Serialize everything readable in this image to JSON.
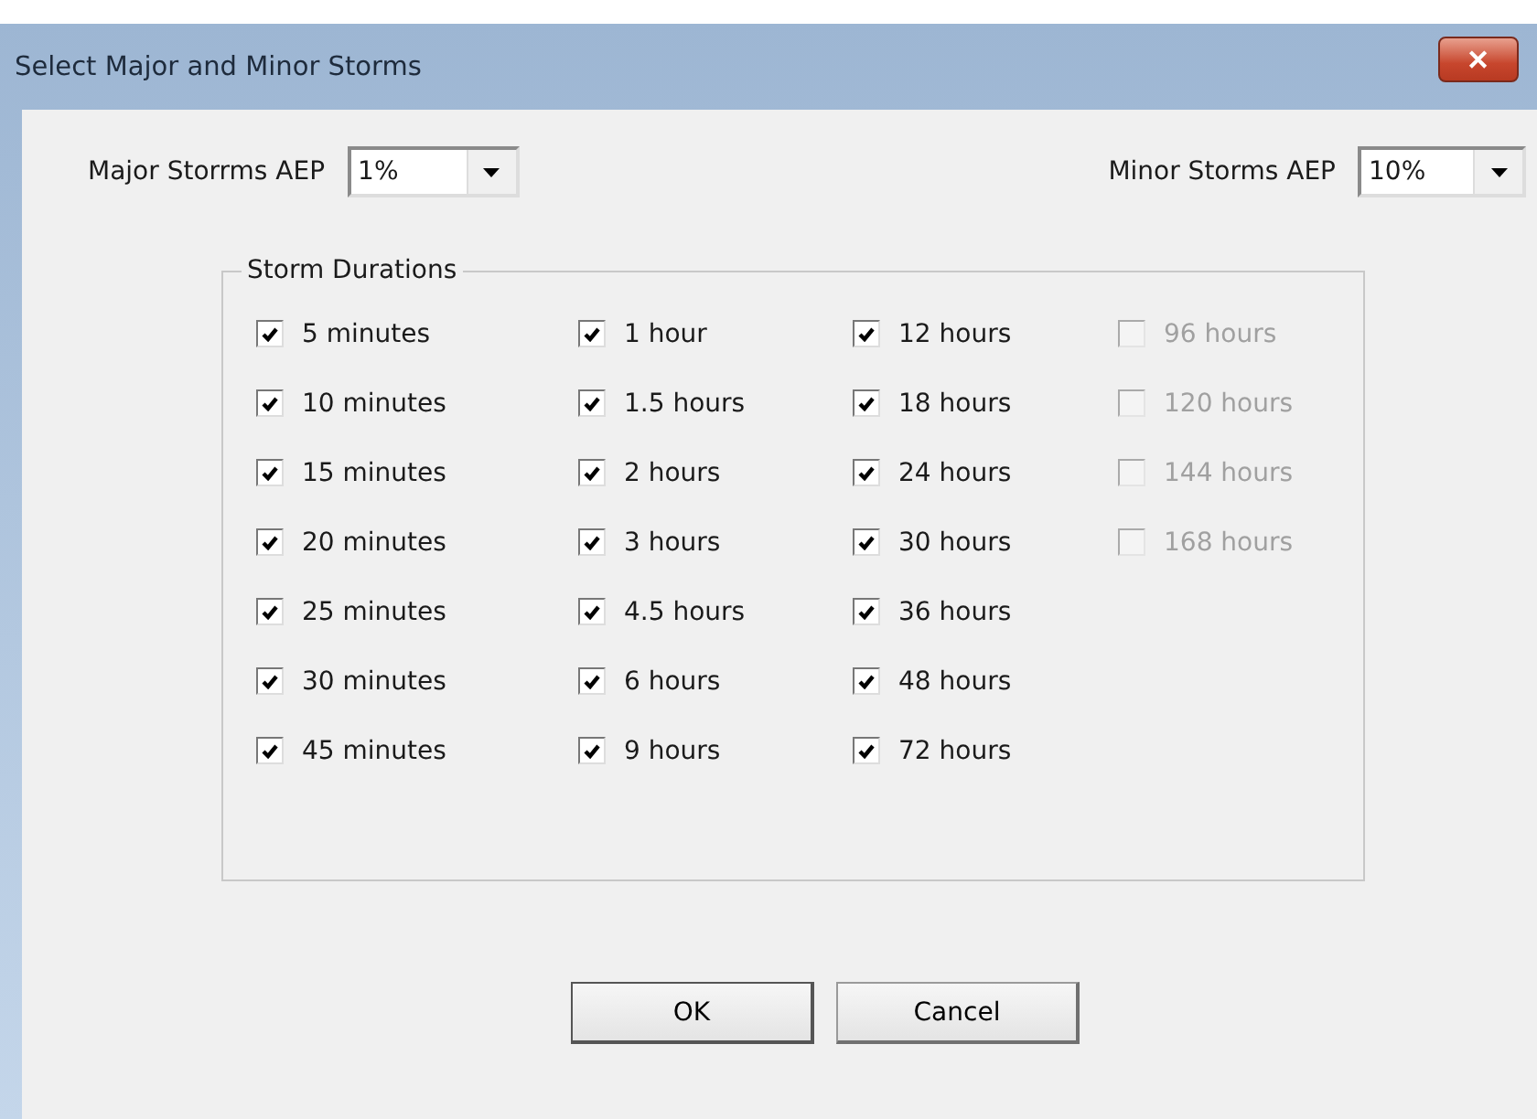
{
  "window": {
    "title": "Select Major and Minor Storms",
    "close": "✕"
  },
  "major": {
    "label": "Major Storrms AEP",
    "value": "1%"
  },
  "minor": {
    "label": "Minor Storms AEP",
    "value": "10%"
  },
  "group": {
    "title": "Storm Durations",
    "columns": [
      [
        {
          "label": "5 minutes",
          "checked": true,
          "disabled": false
        },
        {
          "label": "10 minutes",
          "checked": true,
          "disabled": false
        },
        {
          "label": "15 minutes",
          "checked": true,
          "disabled": false
        },
        {
          "label": "20 minutes",
          "checked": true,
          "disabled": false
        },
        {
          "label": "25 minutes",
          "checked": true,
          "disabled": false
        },
        {
          "label": "30 minutes",
          "checked": true,
          "disabled": false
        },
        {
          "label": "45 minutes",
          "checked": true,
          "disabled": false
        }
      ],
      [
        {
          "label": "1 hour",
          "checked": true,
          "disabled": false
        },
        {
          "label": "1.5 hours",
          "checked": true,
          "disabled": false
        },
        {
          "label": "2 hours",
          "checked": true,
          "disabled": false
        },
        {
          "label": "3 hours",
          "checked": true,
          "disabled": false
        },
        {
          "label": "4.5 hours",
          "checked": true,
          "disabled": false
        },
        {
          "label": "6 hours",
          "checked": true,
          "disabled": false
        },
        {
          "label": "9 hours",
          "checked": true,
          "disabled": false
        }
      ],
      [
        {
          "label": "12 hours",
          "checked": true,
          "disabled": false
        },
        {
          "label": "18 hours",
          "checked": true,
          "disabled": false
        },
        {
          "label": "24 hours",
          "checked": true,
          "disabled": false
        },
        {
          "label": "30 hours",
          "checked": true,
          "disabled": false
        },
        {
          "label": "36 hours",
          "checked": true,
          "disabled": false
        },
        {
          "label": "48 hours",
          "checked": true,
          "disabled": false
        },
        {
          "label": "72 hours",
          "checked": true,
          "disabled": false
        }
      ],
      [
        {
          "label": "96 hours",
          "checked": false,
          "disabled": true
        },
        {
          "label": "120 hours",
          "checked": false,
          "disabled": true
        },
        {
          "label": "144 hours",
          "checked": false,
          "disabled": true
        },
        {
          "label": "168 hours",
          "checked": false,
          "disabled": true
        }
      ]
    ]
  },
  "buttons": [
    "OK",
    "Cancel"
  ]
}
